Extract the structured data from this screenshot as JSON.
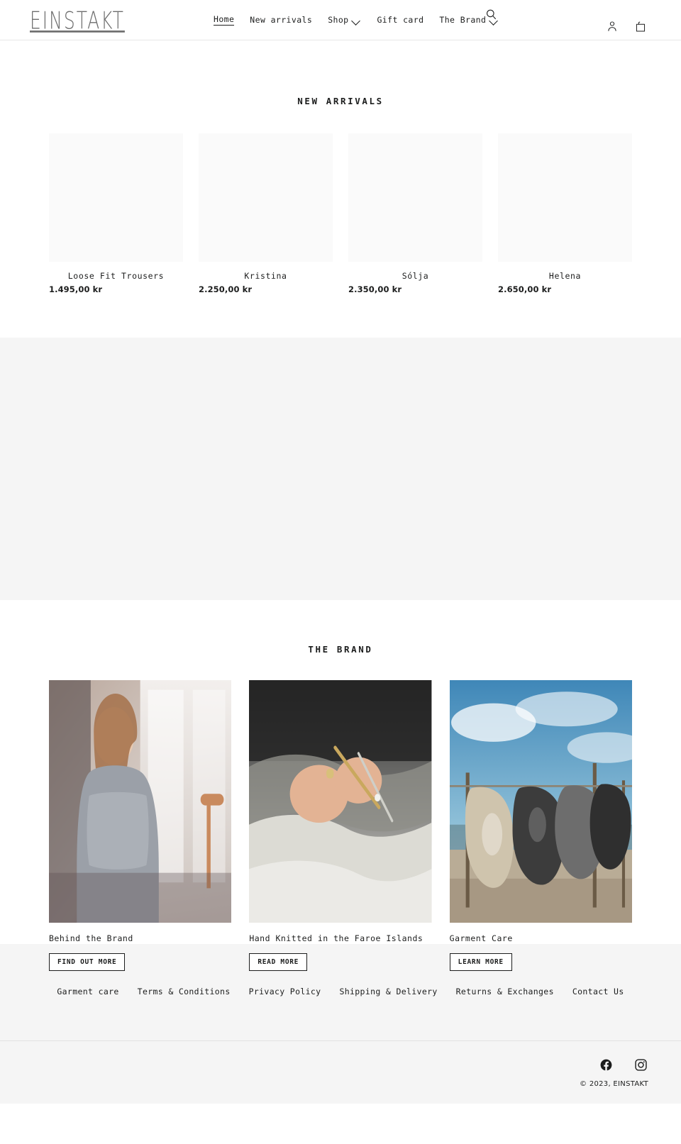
{
  "header": {
    "logo": "EINSTAKT",
    "nav": [
      {
        "label": "Home",
        "active": true,
        "has_caret": false
      },
      {
        "label": "New arrivals",
        "active": false,
        "has_caret": false
      },
      {
        "label": "Shop",
        "active": false,
        "has_caret": true
      },
      {
        "label": "Gift card",
        "active": false,
        "has_caret": false
      },
      {
        "label": "The Brand",
        "active": false,
        "has_caret": true
      }
    ],
    "icons": {
      "search": "search-icon",
      "account": "account-icon",
      "cart": "cart-icon"
    }
  },
  "new_arrivals": {
    "title": "NEW ARRIVALS",
    "products": [
      {
        "title": "Loose Fit Trousers",
        "price": "1.495,00 kr"
      },
      {
        "title": "Kristina",
        "price": "2.250,00 kr"
      },
      {
        "title": "Sólja",
        "price": "2.350,00 kr"
      },
      {
        "title": "Helena",
        "price": "2.650,00 kr"
      }
    ]
  },
  "banner": {
    "background_color": "#f5f5f5"
  },
  "the_brand": {
    "title": "THE BRAND",
    "cards": [
      {
        "title": "Behind the Brand",
        "button": "FIND OUT MORE",
        "image": "woman-in-grey-sweater-by-window"
      },
      {
        "title": "Hand Knitted in the Faroe Islands",
        "button": "READ MORE",
        "image": "hands-knitting-wool"
      },
      {
        "title": "Garment Care",
        "button": "LEARN MORE",
        "image": "knitwear-drying-on-line-by-sea"
      }
    ]
  },
  "footer": {
    "links": [
      "Garment care",
      "Terms & Conditions",
      "Privacy Policy",
      "Shipping & Delivery",
      "Returns & Exchanges",
      "Contact Us"
    ],
    "social": [
      {
        "name": "Facebook"
      },
      {
        "name": "Instagram"
      }
    ],
    "copyright": "© 2023, EINSTAKT"
  },
  "colors": {
    "text": "#1c1d1d",
    "muted_surface": "#f5f5f5",
    "placeholder": "#fafafa",
    "border": "#e8e8e8"
  }
}
